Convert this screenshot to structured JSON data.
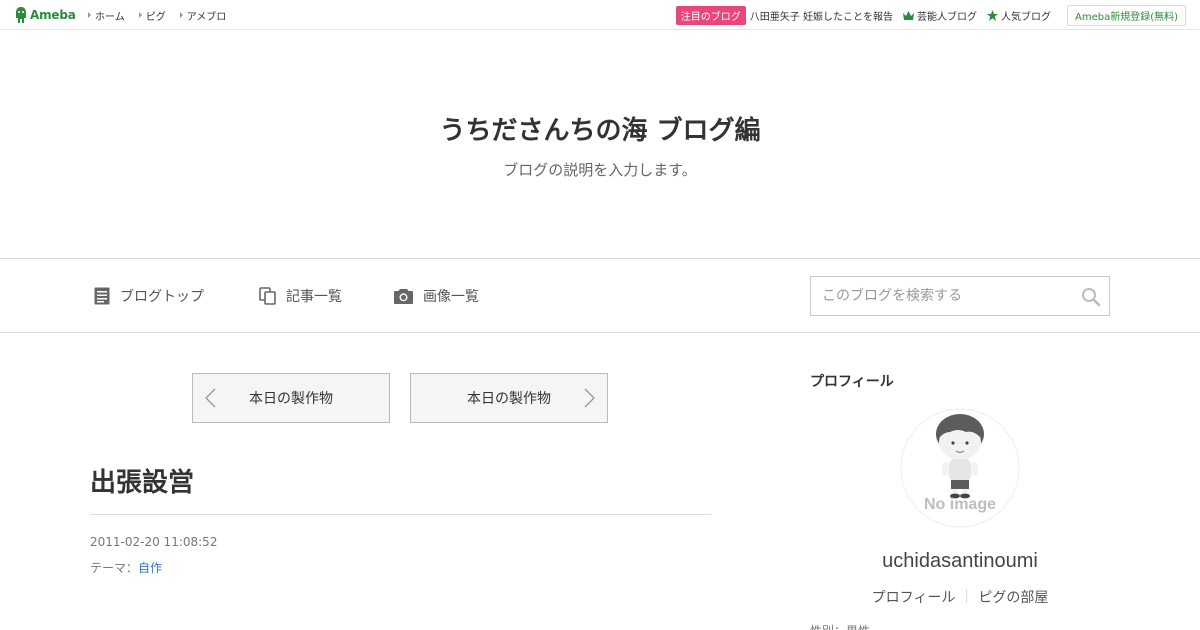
{
  "global_header": {
    "logo_text": "Ameba",
    "nav": [
      "ホーム",
      "ピグ",
      "アメブロ"
    ],
    "pickup_badge": "注目のブログ",
    "pickup_text": "八田亜矢子 妊娠したことを報告",
    "rank_links": [
      "芸能人ブログ",
      "人気ブログ"
    ],
    "signup": "Ameba新規登録(無料)"
  },
  "blog_header": {
    "title": "うちださんちの海 ブログ編",
    "description": "ブログの説明を入力します。"
  },
  "blog_nav": {
    "top": "ブログトップ",
    "entries": "記事一覧",
    "images": "画像一覧",
    "search_placeholder": "このブログを検索する"
  },
  "pager": {
    "prev": "本日の製作物",
    "next": "本日の製作物"
  },
  "article": {
    "title": "出張設営",
    "date": "2011-02-20 11:08:52",
    "theme_label": "テーマ：",
    "theme": "自作"
  },
  "profile": {
    "heading": "プロフィール",
    "avatar_text": "No image",
    "name": "uchidasantinoumi",
    "links": [
      "プロフィール",
      "ピグの部屋"
    ],
    "cut_text": "性別：男性"
  },
  "colors": {
    "ameba_green": "#2d8c3c",
    "badge_pink": "#e8467c",
    "link_blue": "#3a74b4"
  }
}
